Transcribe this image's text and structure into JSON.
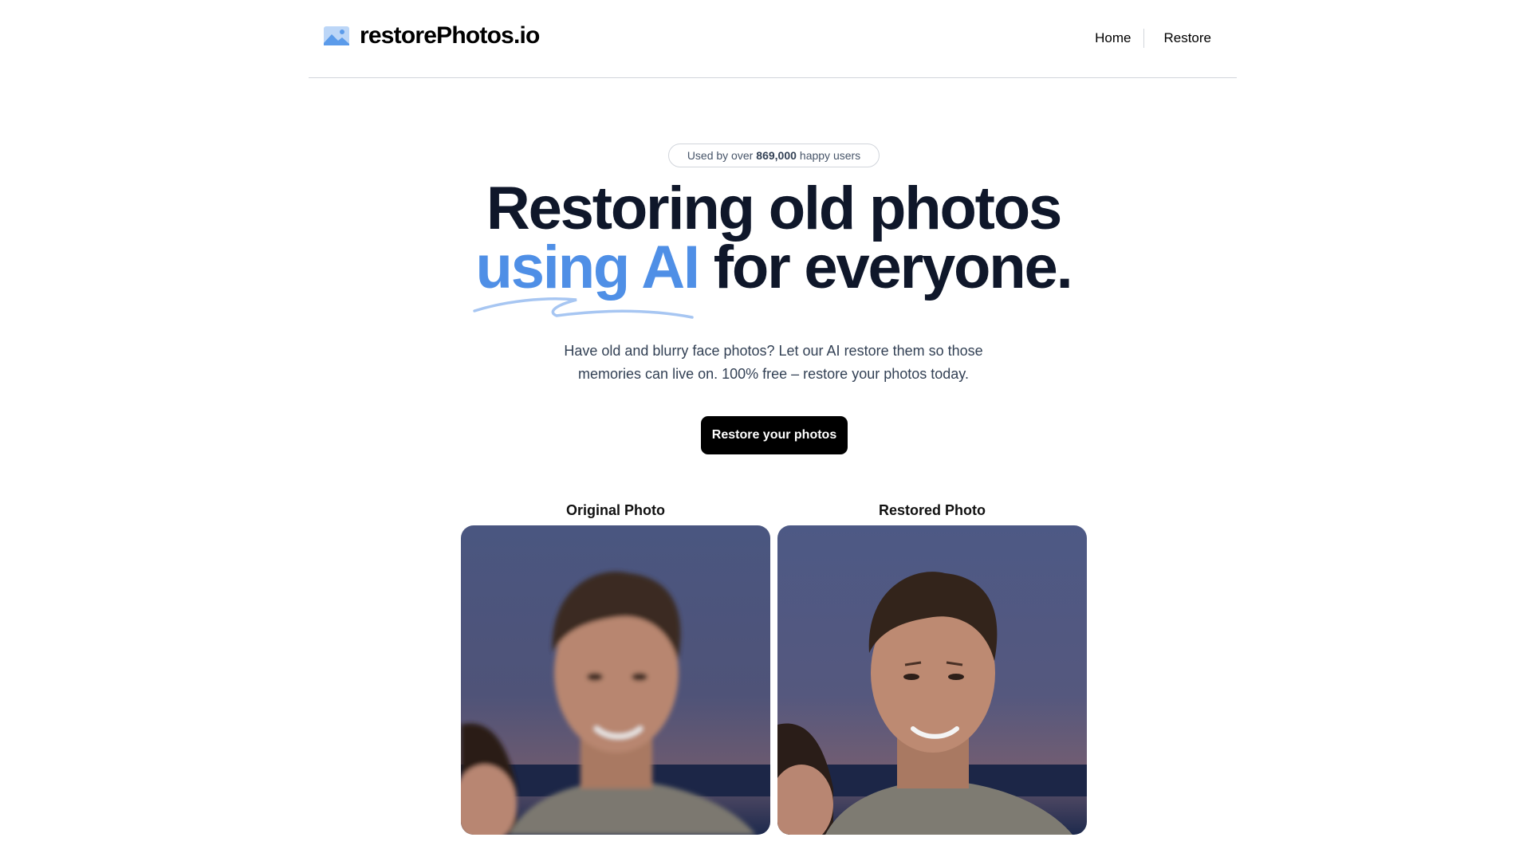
{
  "header": {
    "logo_text": "restorePhotos.io",
    "logo_icon": "photo-icon",
    "nav": [
      {
        "label": "Home"
      },
      {
        "label": "Restore"
      }
    ]
  },
  "hero": {
    "badge_prefix": "Used by over",
    "badge_count": "869,000",
    "badge_suffix": "happy users",
    "title_line1": "Restoring old photos",
    "title_highlight": "using AI",
    "title_line2_rest": "for everyone.",
    "subtext": "Have old and blurry face photos? Let our AI restore them so those memories can live on. 100% free – restore your photos today.",
    "cta_label": "Restore your photos"
  },
  "comparison": {
    "original_label": "Original Photo",
    "restored_label": "Restored Photo"
  },
  "colors": {
    "accent": "#4f8fe6",
    "text": "#0f172a",
    "cta_bg": "#000000"
  }
}
